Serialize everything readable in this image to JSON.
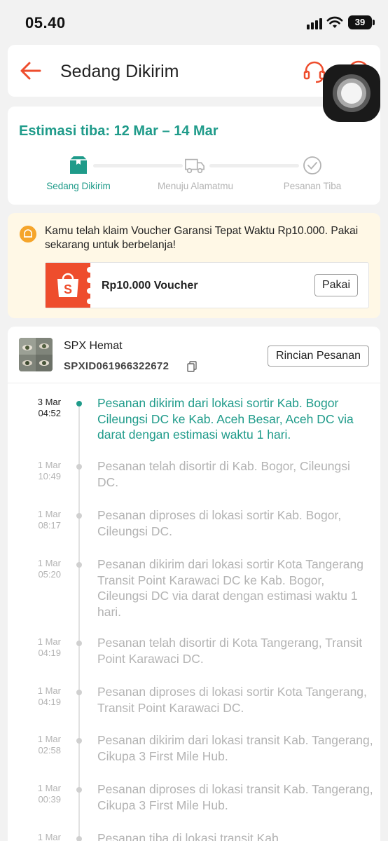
{
  "status_bar": {
    "time": "05.40",
    "battery": "39"
  },
  "header": {
    "title": "Sedang Dikirim"
  },
  "estimate": {
    "title": "Estimasi tiba: 12 Mar – 14 Mar",
    "steps": [
      {
        "label": "Sedang Dikirim",
        "active": true
      },
      {
        "label": "Menuju Alamatmu",
        "active": false
      },
      {
        "label": "Pesanan Tiba",
        "active": false
      }
    ]
  },
  "voucher": {
    "message": "Kamu telah klaim Voucher Garansi Tepat Waktu Rp10.000. Pakai sekarang untuk berbelanja!",
    "name": "Rp10.000 Voucher",
    "button": "Pakai"
  },
  "shipment": {
    "courier": "SPX Hemat",
    "tracking_number": "SPXID061966322672",
    "detail_button": "Rincian Pesanan"
  },
  "timeline": [
    {
      "date": "3 Mar",
      "time": "04:52",
      "text": "Pesanan dikirim dari lokasi sortir Kab. Bogor Cileungsi DC ke Kab. Aceh Besar, Aceh DC via darat dengan estimasi waktu 1 hari."
    },
    {
      "date": "1 Mar",
      "time": "10:49",
      "text": "Pesanan telah disortir di Kab. Bogor, Cileungsi DC."
    },
    {
      "date": "1 Mar",
      "time": "08:17",
      "text": "Pesanan diproses di lokasi sortir Kab. Bogor, Cileungsi DC."
    },
    {
      "date": "1 Mar",
      "time": "05:20",
      "text": "Pesanan dikirim dari lokasi sortir Kota Tangerang  Transit Point Karawaci DC ke Kab. Bogor, Cileungsi DC via darat dengan estimasi waktu 1 hari."
    },
    {
      "date": "1 Mar",
      "time": "04:19",
      "text": "Pesanan telah disortir di Kota Tangerang, Transit Point Karawaci DC."
    },
    {
      "date": "1 Mar",
      "time": "04:19",
      "text": "Pesanan diproses di lokasi sortir Kota Tangerang, Transit Point Karawaci DC."
    },
    {
      "date": "1 Mar",
      "time": "02:58",
      "text": "Pesanan dikirim dari lokasi transit Kab. Tangerang, Cikupa 3 First Mile Hub."
    },
    {
      "date": "1 Mar",
      "time": "00:39",
      "text": "Pesanan diproses di lokasi transit Kab. Tangerang, Cikupa 3 First Mile Hub."
    },
    {
      "date": "1 Mar",
      "time": "",
      "text": "Pesanan tiba di lokasi transit Kab."
    }
  ],
  "colors": {
    "accent": "#1f9b8a",
    "brand": "#ee4d2d",
    "header_icons": "#ee4d2d"
  }
}
